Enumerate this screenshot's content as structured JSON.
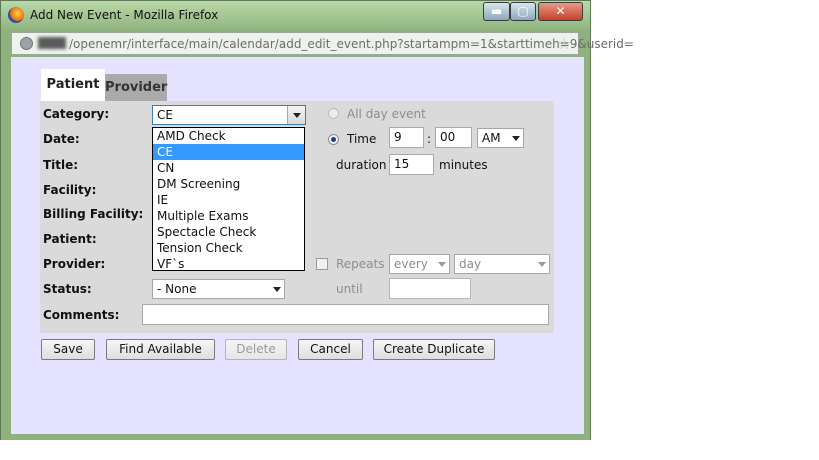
{
  "window": {
    "title": "Add New Event - Mozilla Firefox",
    "url": "/openemr/interface/main/calendar/add_edit_event.php?startampm=1&starttimeh=9&userid=",
    "min_glyph": "▬",
    "max_glyph": "▢",
    "close_glyph": "✕"
  },
  "tabs": [
    {
      "label": "Patient",
      "active": true
    },
    {
      "label": "Provider",
      "active": false
    }
  ],
  "form": {
    "labels": {
      "category": "Category:",
      "date": "Date:",
      "title": "Title:",
      "facility": "Facility:",
      "billing_facility": "Billing Facility:",
      "patient": "Patient:",
      "provider": "Provider:",
      "status": "Status:",
      "comments": "Comments:"
    },
    "category": {
      "value": "CE",
      "options": [
        "AMD Check",
        "CE",
        "CN",
        "DM Screening",
        "IE",
        "Multiple Exams",
        "Spectacle Check",
        "Tension Check",
        "VF`s"
      ],
      "highlighted": "CE"
    },
    "all_day_label": "All day event",
    "time_label": "Time",
    "time_hour": "9",
    "time_sep": ":",
    "time_min": "00",
    "ampm": "AM",
    "duration_label": "duration",
    "duration_value": "15",
    "minutes_label": "minutes",
    "repeats_label": "Repeats",
    "repeat_every": "every",
    "repeat_unit": "day",
    "until_label": "until",
    "status_value": "- None",
    "comments_value": ""
  },
  "buttons": {
    "save": "Save",
    "find_available": "Find Available",
    "delete": "Delete",
    "cancel": "Cancel",
    "create_duplicate": "Create Duplicate"
  }
}
